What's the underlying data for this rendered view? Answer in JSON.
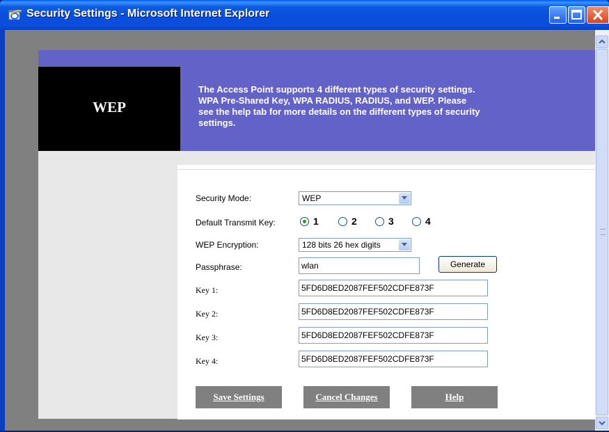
{
  "window": {
    "title": "Security Settings - Microsoft Internet Explorer",
    "icon": "ie-icon",
    "controls": [
      "minimize-icon",
      "maximize-icon",
      "close-icon"
    ]
  },
  "banner": {
    "title": "WEP",
    "lines": [
      "The Access Point supports 4 different types of security settings.",
      "WPA Pre-Shared Key, WPA RADIUS, RADIUS, and WEP. Please",
      "see the help tab for more details on the different types of security",
      "settings."
    ]
  },
  "form": {
    "security_mode": {
      "label": "Security Mode:",
      "value": "WEP"
    },
    "transmit_key": {
      "label": "Default Transmit Key:",
      "options": [
        "1",
        "2",
        "3",
        "4"
      ],
      "selected": "1"
    },
    "encryption": {
      "label": "WEP Encryption:",
      "value": "128 bits 26 hex digits"
    },
    "passphrase": {
      "label": "Passphrase:",
      "value": "wlan",
      "button": "Generate"
    },
    "keys": [
      {
        "label": "Key 1:",
        "value": "5FD6D8ED2087FEF502CDFE873F"
      },
      {
        "label": "Key 2:",
        "value": "5FD6D8ED2087FEF502CDFE873F"
      },
      {
        "label": "Key 3:",
        "value": "5FD6D8ED2087FEF502CDFE873F"
      },
      {
        "label": "Key 4:",
        "value": "5FD6D8ED2087FEF502CDFE873F"
      }
    ]
  },
  "actions": {
    "save": "Save Settings",
    "cancel": "Cancel Changes",
    "help": "Help"
  },
  "colors": {
    "banner": "#6262c8",
    "titlebar": "#0a4ddb",
    "button_gray": "#808080"
  }
}
